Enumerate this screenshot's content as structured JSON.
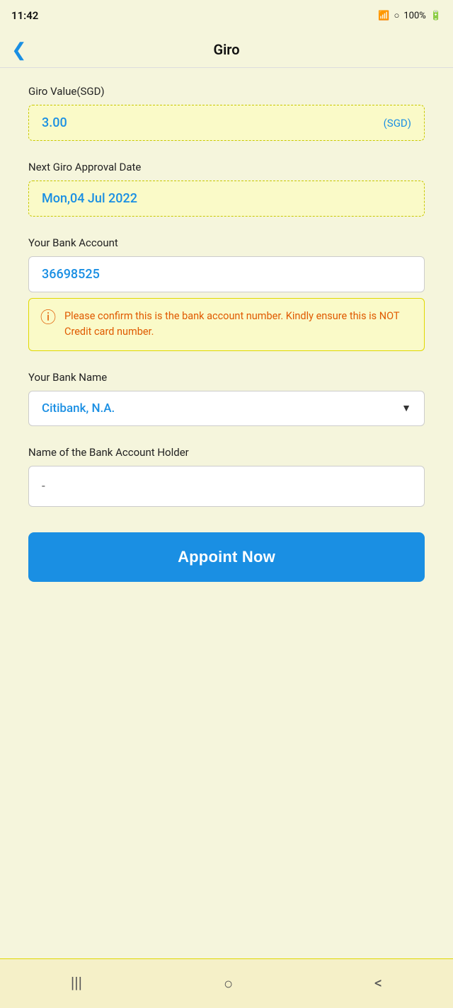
{
  "statusBar": {
    "time": "11:42",
    "battery": "100%"
  },
  "header": {
    "title": "Giro",
    "backLabel": "‹"
  },
  "form": {
    "giroValueLabel": "Giro Value(SGD)",
    "giroValue": "3.00",
    "giroCurrency": "(SGD)",
    "nextGiroDateLabel": "Next Giro Approval Date",
    "nextGiroDate": "Mon,04 Jul 2022",
    "bankAccountLabel": "Your Bank Account",
    "bankAccountValue": "36698525",
    "warningText": "Please confirm this is the bank account number. Kindly ensure this is NOT Credit card number.",
    "bankNameLabel": "Your Bank Name",
    "bankNameValue": "Citibank, N.A.",
    "holderNameLabel": "Name of the Bank Account Holder",
    "holderNameValue": "-"
  },
  "buttons": {
    "appointNow": "Appoint Now"
  },
  "bottomNav": {
    "menu": "|||",
    "home": "○",
    "back": "<"
  }
}
